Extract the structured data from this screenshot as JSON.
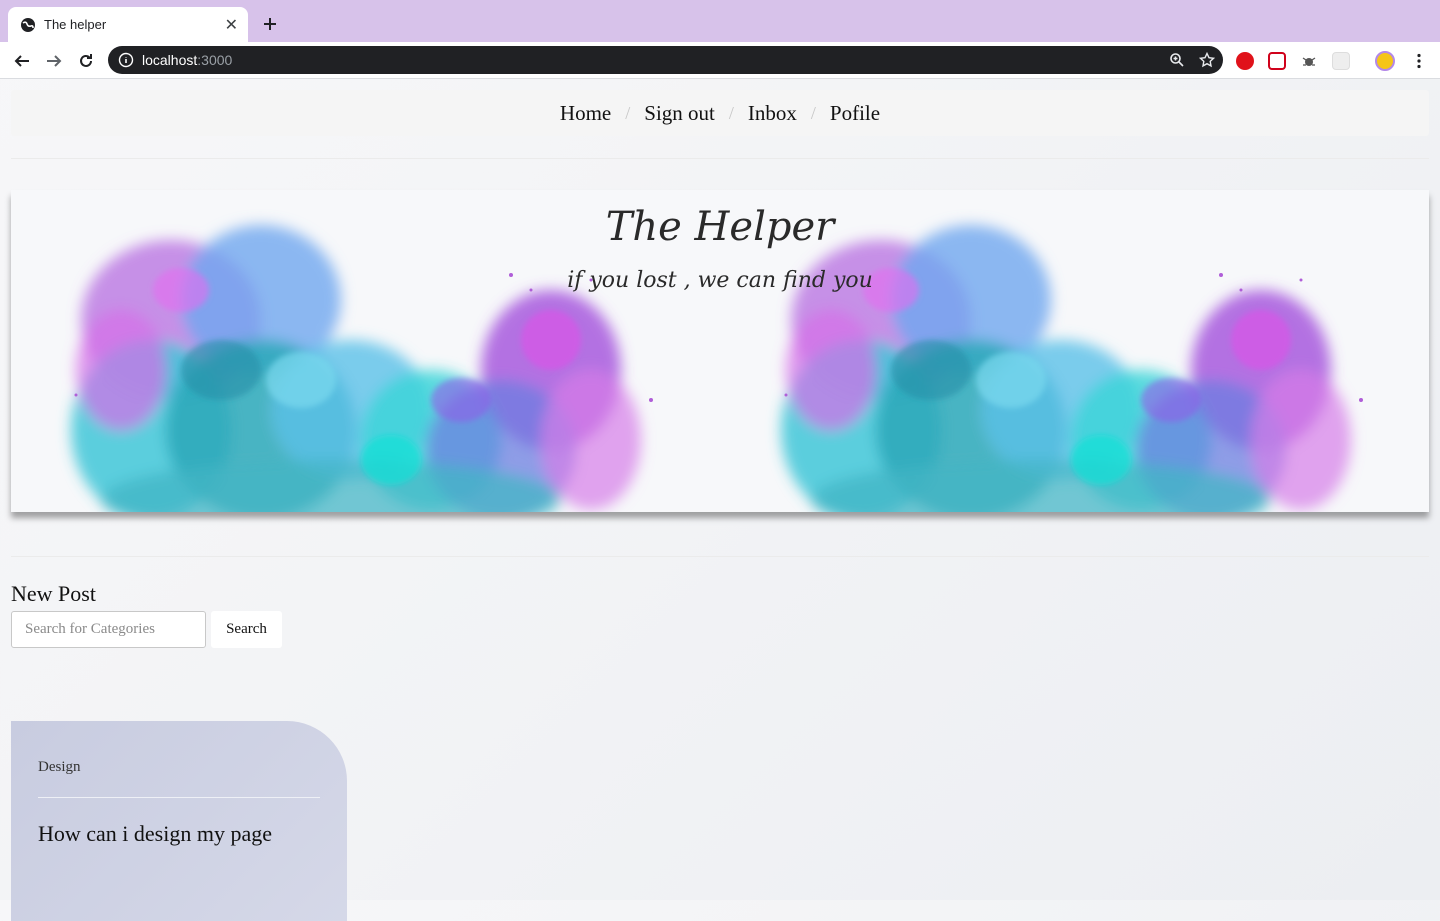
{
  "browser": {
    "tab_title": "The helper",
    "tab_close": "✕",
    "new_tab": "+",
    "url_host": "localhost",
    "url_port": ":3000"
  },
  "nav": {
    "items": [
      "Home",
      "Sign out",
      "Inbox",
      "Pofile"
    ],
    "separator": "/"
  },
  "hero": {
    "title": "The Helper",
    "subtitle": "if you lost , we can find you"
  },
  "new_post": {
    "heading": "New Post",
    "search_placeholder": "Search for Categories",
    "search_button": "Search"
  },
  "posts": [
    {
      "category": "Design",
      "title": "How can i design my page"
    }
  ],
  "colors": {
    "tabstrip": "#d7c2ea",
    "omnibox": "#202124",
    "card": "#c8cce0"
  }
}
